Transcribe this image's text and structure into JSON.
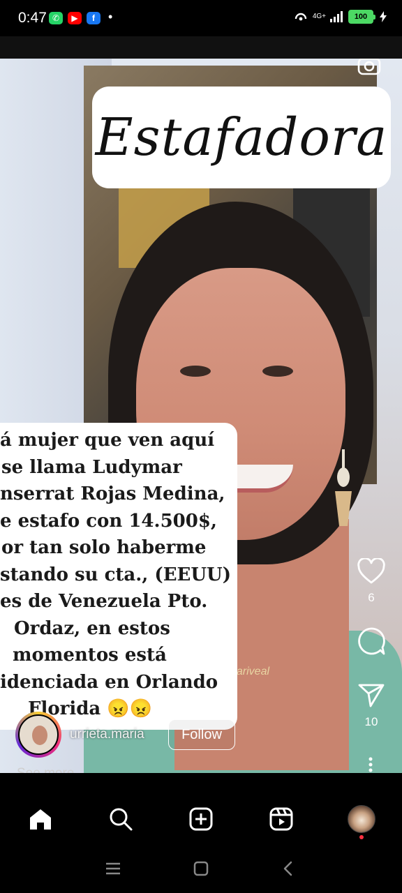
{
  "status_bar": {
    "time": "0:47",
    "dot": "•",
    "network": "4G+",
    "battery": "100",
    "apps": [
      {
        "name": "whatsapp-icon",
        "glyph": "✆",
        "color": "#25D366"
      },
      {
        "name": "youtube-icon",
        "glyph": "▶",
        "color": "#FF0000"
      },
      {
        "name": "facebook-icon",
        "glyph": "f",
        "color": "#1877F2"
      }
    ]
  },
  "post": {
    "overlay_title": "Estafadora",
    "caption_lines": [
      "á mujer que ven aquí",
      "se llama Ludymar",
      "nserrat Rojas Medina,",
      "e estafo con 14.500$,",
      "or tan solo haberme",
      "stando su cta., (EEUU)",
      "es de Venezuela Pto.",
      "Ordaz, en estos",
      "momentos está",
      "idenciada  en Orlando",
      "Florida 😠😠"
    ],
    "necklace_text": "Lariveal"
  },
  "actions": {
    "like_count": "6",
    "share_count": "10"
  },
  "author": {
    "username": "urrieta.maria",
    "follow_label": "Follow",
    "see_more": "See more"
  },
  "colors": {
    "accent_red": "#ff3040",
    "battery_green": "#4cd964"
  }
}
